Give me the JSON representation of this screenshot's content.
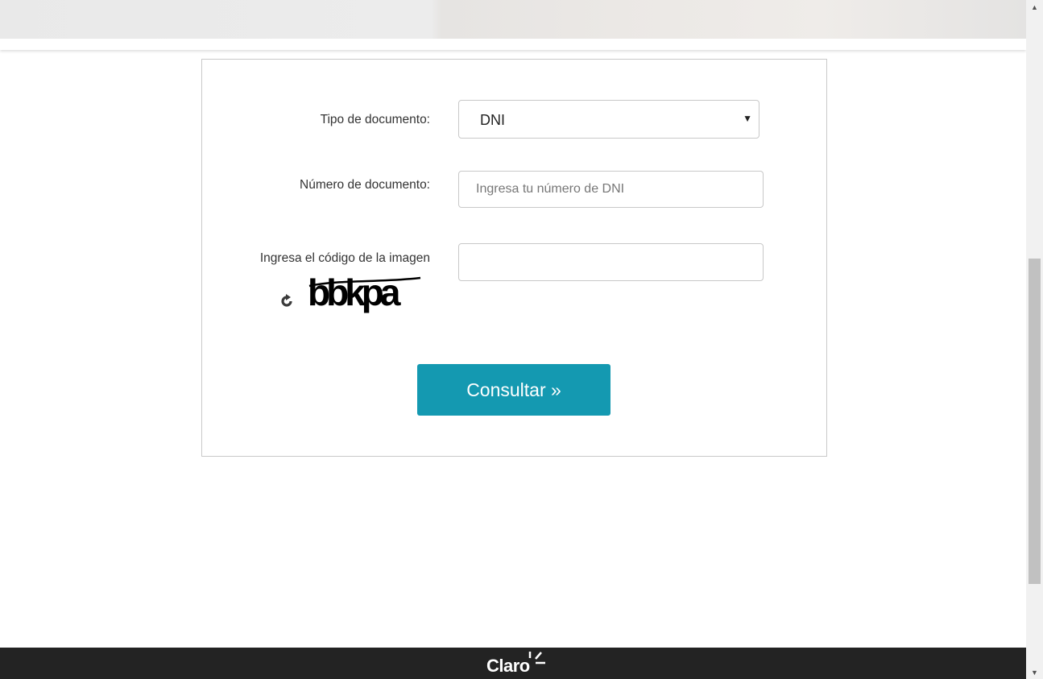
{
  "form": {
    "doc_type_label": "Tipo de documento:",
    "doc_type_value": "DNI",
    "doc_number_label": "Número de documento:",
    "doc_number_placeholder": "Ingresa tu número de DNI",
    "doc_number_value": "",
    "captcha_label": "Ingresa el código de la imagen",
    "captcha_text": "bbkpa",
    "captcha_value": "",
    "submit_label": "Consultar »"
  },
  "footer": {
    "logo_text": "Claro"
  },
  "colors": {
    "accent": "#1499b1",
    "footer_bg": "#232323"
  },
  "icons": {
    "refresh": "refresh-icon",
    "select_caret": "caret-down-icon"
  }
}
